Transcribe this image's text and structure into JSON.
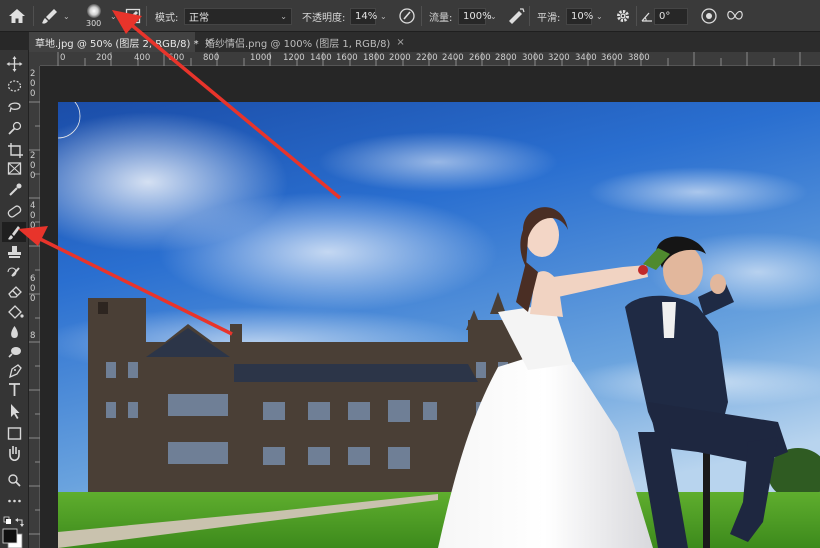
{
  "options_bar": {
    "brush_size": "300",
    "mode_label": "模式:",
    "mode_value": "正常",
    "opacity_label": "不透明度:",
    "opacity_value": "14%",
    "flow_label": "流量:",
    "flow_value": "100%",
    "smoothing_label": "平滑:",
    "smoothing_value": "10%",
    "angle_value": "0°"
  },
  "tabs": [
    {
      "label": "草地.jpg @ 50% (图层 2, RGB/8) *",
      "close": "×"
    },
    {
      "label": "婚纱情侣.png @ 100% (图层 1, RGB/8)",
      "close": "×"
    }
  ],
  "ruler": {
    "h_ticks": [
      "0",
      "200",
      "400",
      "600",
      "800",
      "1000",
      "1200",
      "1400",
      "1600",
      "1800",
      "2000",
      "2200",
      "2400",
      "2600",
      "2800",
      "3000",
      "3200",
      "3400",
      "3600",
      "3800"
    ],
    "v_ticks": [
      "2",
      "0",
      "0",
      "2",
      "0",
      "0",
      "4",
      "0",
      "0",
      "6",
      "0",
      "0",
      "8"
    ]
  },
  "tools": [
    "move-icon",
    "marquee-icon",
    "lasso-icon",
    "quick-select-icon",
    "crop-icon",
    "frame-icon",
    "eyedropper-icon",
    "spot-heal-icon",
    "brush-icon",
    "stamp-icon",
    "history-brush-icon",
    "eraser-icon",
    "bucket-icon",
    "blur-icon",
    "dodge-icon",
    "pen-icon",
    "type-icon",
    "path-select-icon",
    "rectangle-icon",
    "hand-icon",
    "zoom-icon",
    "more-icon"
  ],
  "colors": {
    "annotation_arrow": "#e8342b",
    "ui_panel": "#3a3a3a",
    "canvas_bg": "#262626"
  }
}
